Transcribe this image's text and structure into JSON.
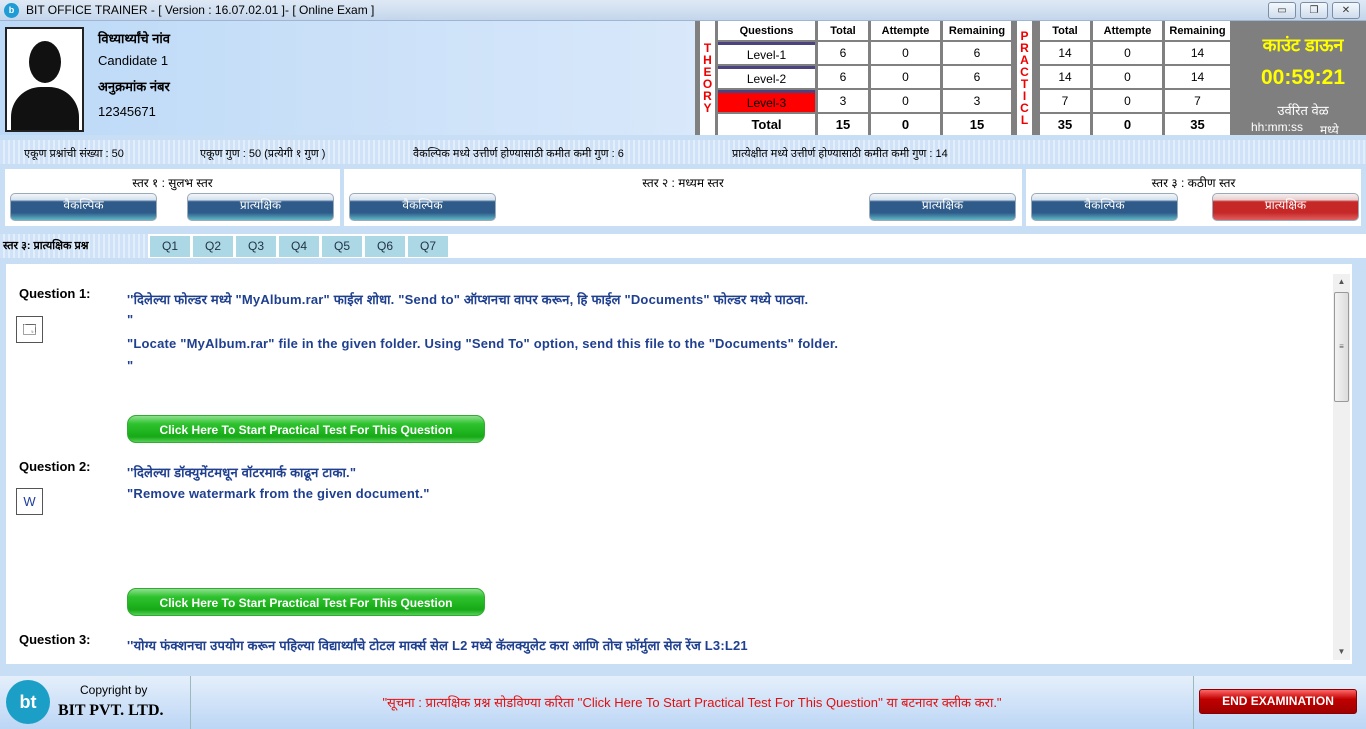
{
  "window": {
    "title": "BIT OFFICE TRAINER - [ Version : 16.07.02.01 ]- [ Online Exam ]",
    "minimize": "▭",
    "restore": "❐",
    "close": "✕"
  },
  "candidate": {
    "name_label": "विध्यार्थ्यांचे नांव",
    "name": "Candidate 1",
    "roll_label": "अनुक्रमांक नंबर",
    "roll": "12345671"
  },
  "stats": {
    "theory_label": "THEORY",
    "practical_label": "PRACTICL",
    "headers": [
      "Questions",
      "Total",
      "Attempte",
      "Remaining",
      "Total",
      "Attempte",
      "Remaining"
    ],
    "rows": [
      {
        "label": "Level-1",
        "theory": [
          "6",
          "0",
          "6"
        ],
        "practical": [
          "14",
          "0",
          "14"
        ]
      },
      {
        "label": "Level-2",
        "theory": [
          "6",
          "0",
          "6"
        ],
        "practical": [
          "14",
          "0",
          "14"
        ]
      },
      {
        "label": "Level-3",
        "theory": [
          "3",
          "0",
          "3"
        ],
        "practical": [
          "7",
          "0",
          "7"
        ],
        "highlight": "#ff0000"
      },
      {
        "label": "Total",
        "theory": [
          "15",
          "0",
          "15"
        ],
        "practical": [
          "35",
          "0",
          "35"
        ]
      }
    ]
  },
  "timer": {
    "title": "काउंट डाऊन",
    "value": "00:59:21",
    "remaining_label": "उर्वरित वेळ",
    "format": "hh:mm:ss",
    "suffix": "मध्ये",
    "color": "#ffff00"
  },
  "info": {
    "total_questions": "एकूण प्रश्नांची संख्या : 50",
    "total_marks": "एकूण गुण : 50 (प्रत्येगी १ गुण )",
    "theory_pass": "वैकल्पिक मध्ये उत्तीर्ण होण्यासाठी कमीत कमी गुण   : 6",
    "practical_pass": "प्रात्येक्षीत मध्ये उत्तीर्ण होण्यासाठी कमीत कमी गुण   : 14"
  },
  "levels": [
    {
      "title": "स्तर १ : सुलभ स्तर",
      "theory": "वैकल्पिक",
      "practical": "प्रात्यक्षिक"
    },
    {
      "title": "स्तर २ : मध्यम स्तर",
      "theory": "वैकल्पिक",
      "practical": "प्रात्यक्षिक"
    },
    {
      "title": "स्तर ३ : कठीण स्तर",
      "theory": "वैकल्पिक",
      "practical": "प्रात्यक्षिक"
    }
  ],
  "qtabs": {
    "label": "स्तर ३: प्रात्यक्षिक प्रश्न",
    "tabs": [
      "Q1",
      "Q2",
      "Q3",
      "Q4",
      "Q5",
      "Q6",
      "Q7"
    ]
  },
  "questions": [
    {
      "label": "Question 1:",
      "lines": [
        "''दिलेल्या फोल्डर मध्ये \"MyAlbum.rar\" फाईल शोधा. \"Send to\" ऑप्शनचा वापर करून, हि फाईल \"Documents\" फोल्डर मध्ये पाठवा.",
        "\"",
        "\"Locate \"MyAlbum.rar\" file in the given folder. Using \"Send To\" option, send this file to the \"Documents\" folder.",
        "\""
      ],
      "icon": "windows-explorer-icon",
      "button": "Click Here To Start Practical Test For This Question"
    },
    {
      "label": "Question 2:",
      "lines": [
        "''दिलेल्या डॉक्युमेंटमधून वॉटरमार्क काढून टाका.\"",
        "\"Remove watermark from the given document.\""
      ],
      "icon": "word-document-icon",
      "button": "Click Here To Start Practical Test For This Question"
    },
    {
      "label": "Question 3:",
      "lines": [
        "''योग्य फंक्शनचा उपयोग करून पहिल्या विद्यार्थ्यांचे टोटल मार्क्स सेल L2 मध्ये  कॅलक्युलेट करा आणि तोच फ़ॉर्मुला सेल रेंज L3:L21"
      ]
    }
  ],
  "footer": {
    "copyright": "Copyright by",
    "company": "BIT PVT. LTD.",
    "notice": "\"सूचना : प्रात्यक्षिक प्रश्न सोडविण्या करिता ''Click Here To Start Practical Test For This Question'' या बटनावर क्लीक करा.\"",
    "end_button": "END EXAMINATION"
  }
}
